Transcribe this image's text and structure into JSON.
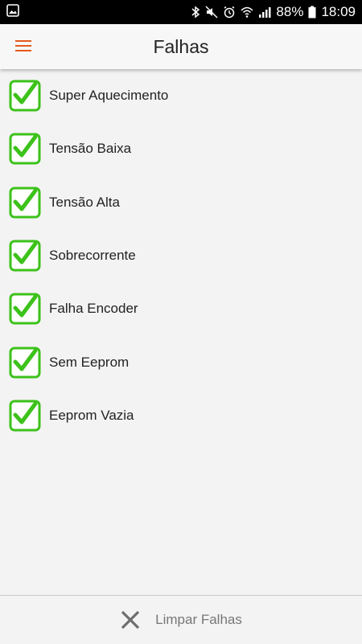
{
  "status_bar": {
    "battery": "88%",
    "time": "18:09"
  },
  "app_bar": {
    "title": "Falhas"
  },
  "faults": [
    {
      "label": "Super Aquecimento",
      "checked": true
    },
    {
      "label": "Tensão Baixa",
      "checked": true
    },
    {
      "label": "Tensão Alta",
      "checked": true
    },
    {
      "label": "Sobrecorrente",
      "checked": true
    },
    {
      "label": "Falha Encoder",
      "checked": true
    },
    {
      "label": "Sem Eeprom",
      "checked": true
    },
    {
      "label": "Eeprom Vazia",
      "checked": true
    }
  ],
  "footer": {
    "clear_label": "Limpar Falhas"
  },
  "colors": {
    "accent": "#e55a1c",
    "check_green": "#3cc21a"
  }
}
